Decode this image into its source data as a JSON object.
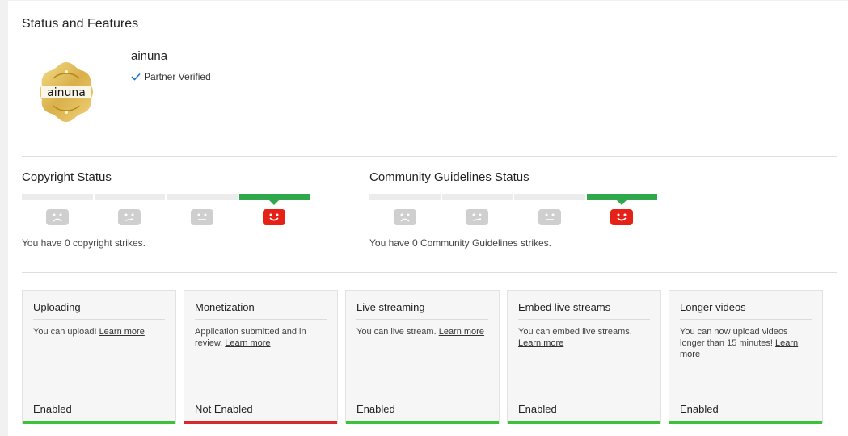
{
  "header": {
    "title": "Status and Features"
  },
  "channel": {
    "name": "ainuna",
    "verified_label": "Partner Verified",
    "logo_text": "ainuna"
  },
  "copyright": {
    "title": "Copyright Status",
    "strikes_text": "You have 0 copyright strikes.",
    "active_level": 4
  },
  "community": {
    "title": "Community Guidelines Status",
    "strikes_text": "You have 0 Community Guidelines strikes.",
    "active_level": 4
  },
  "cards": [
    {
      "title": "Uploading",
      "desc": "You can upload! ",
      "link": "Learn more",
      "status": "Enabled"
    },
    {
      "title": "Monetization",
      "desc": "Application submitted and in review. ",
      "link": "Learn more",
      "status": "Not Enabled"
    },
    {
      "title": "Live streaming",
      "desc": "You can live stream. ",
      "link": "Learn more",
      "status": "Enabled"
    },
    {
      "title": "Embed live streams",
      "desc": "You can embed live streams. ",
      "link": "Learn more",
      "status": "Enabled"
    },
    {
      "title": "Longer videos",
      "desc": "You can now upload videos longer than 15 minutes! ",
      "link": "Learn more",
      "status": "Enabled"
    }
  ],
  "colors": {
    "enabled": "#3cc13b",
    "not_enabled": "#d9272e",
    "active_bar": "#2ea84a",
    "face_active": "#e62117",
    "face_inactive": "#cfcfcf"
  }
}
